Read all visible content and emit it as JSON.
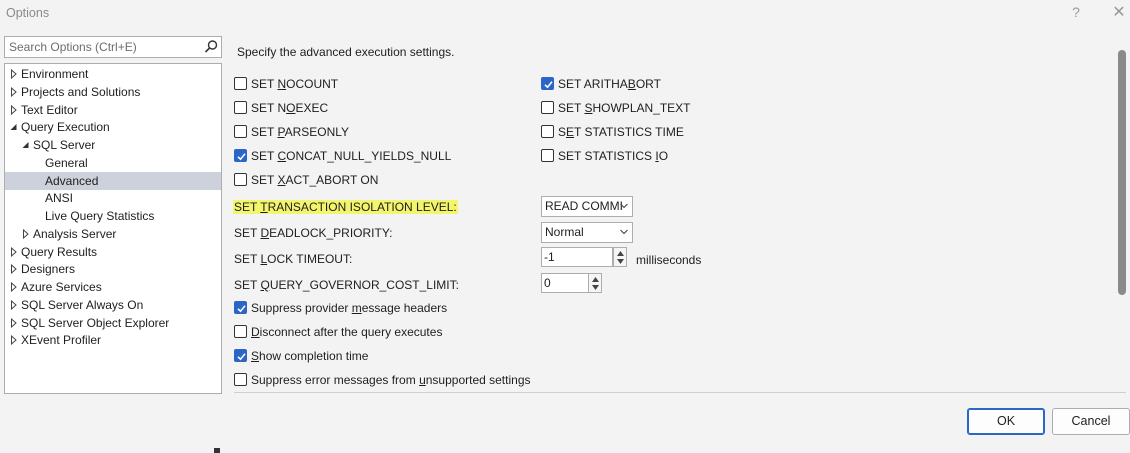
{
  "window": {
    "title": "Options",
    "help_glyph": "?",
    "close_glyph": "✕"
  },
  "search": {
    "placeholder": "Search Options (Ctrl+E)"
  },
  "tree": {
    "items": [
      {
        "label": "Environment",
        "expander": "collapsed"
      },
      {
        "label": "Projects and Solutions",
        "expander": "collapsed"
      },
      {
        "label": "Text Editor",
        "expander": "collapsed"
      },
      {
        "label": "Query Execution",
        "expander": "expanded"
      },
      {
        "label": "SQL Server",
        "expander": "expanded"
      },
      {
        "label": "General",
        "expander": "none"
      },
      {
        "label": "Advanced",
        "expander": "none",
        "selected": true
      },
      {
        "label": "ANSI",
        "expander": "none"
      },
      {
        "label": "Live Query Statistics",
        "expander": "none"
      },
      {
        "label": "Analysis Server",
        "expander": "collapsed"
      },
      {
        "label": "Query Results",
        "expander": "collapsed"
      },
      {
        "label": "Designers",
        "expander": "collapsed"
      },
      {
        "label": "Azure Services",
        "expander": "collapsed"
      },
      {
        "label": "SQL Server Always On",
        "expander": "collapsed"
      },
      {
        "label": "SQL Server Object Explorer",
        "expander": "collapsed"
      },
      {
        "label": "XEvent Profiler",
        "expander": "collapsed"
      }
    ]
  },
  "main": {
    "description": "Specify the advanced execution settings.",
    "left_checks": [
      {
        "pre": "SET ",
        "u": "N",
        "post": "OCOUNT",
        "checked": false
      },
      {
        "pre": "SET N",
        "u": "O",
        "post": "EXEC",
        "checked": false
      },
      {
        "pre": "SET ",
        "u": "P",
        "post": "ARSEONLY",
        "checked": false
      },
      {
        "pre": "SET ",
        "u": "C",
        "post": "ONCAT_NULL_YIELDS_NULL",
        "checked": true
      },
      {
        "pre": "SET ",
        "u": "X",
        "post": "ACT_ABORT ON",
        "checked": false
      }
    ],
    "right_checks": [
      {
        "pre": "SET ARITHA",
        "u": "B",
        "post": "ORT",
        "checked": true
      },
      {
        "pre": "SET ",
        "u": "S",
        "post": "HOWPLAN_TEXT",
        "checked": false
      },
      {
        "pre": "S",
        "u": "E",
        "post": "T STATISTICS TIME",
        "checked": false
      },
      {
        "pre": "SET STATISTICS ",
        "u": "I",
        "post": "O",
        "checked": false
      }
    ],
    "isolation": {
      "pre": "SET ",
      "u": "T",
      "post": "RANSACTION ISOLATION LEVEL:",
      "value": "READ COMMI"
    },
    "deadlock": {
      "pre": "SET ",
      "u": "D",
      "post": "EADLOCK_PRIORITY:",
      "value": "Normal"
    },
    "lock_timeout": {
      "pre": "SET ",
      "u": "L",
      "post": "OCK TIMEOUT:",
      "value": "-1",
      "unit": "milliseconds"
    },
    "governor": {
      "pre": "SET ",
      "u": "Q",
      "post": "UERY_GOVERNOR_COST_LIMIT:",
      "value": "0"
    },
    "bottom_checks": [
      {
        "pre": "Suppress provider ",
        "u": "m",
        "post": "essage headers",
        "checked": true
      },
      {
        "pre": "",
        "u": "D",
        "post": "isconnect after the query executes",
        "checked": false
      },
      {
        "pre": "",
        "u": "S",
        "post": "how completion time",
        "checked": true
      },
      {
        "pre": "Suppress error messages from ",
        "u": "u",
        "post": "nsupported settings",
        "checked": false
      }
    ]
  },
  "buttons": {
    "ok": "OK",
    "cancel": "Cancel"
  },
  "colors": {
    "accent": "#2b66c7",
    "highlight": "#f3f56c",
    "selected_row": "#ccd1db"
  }
}
